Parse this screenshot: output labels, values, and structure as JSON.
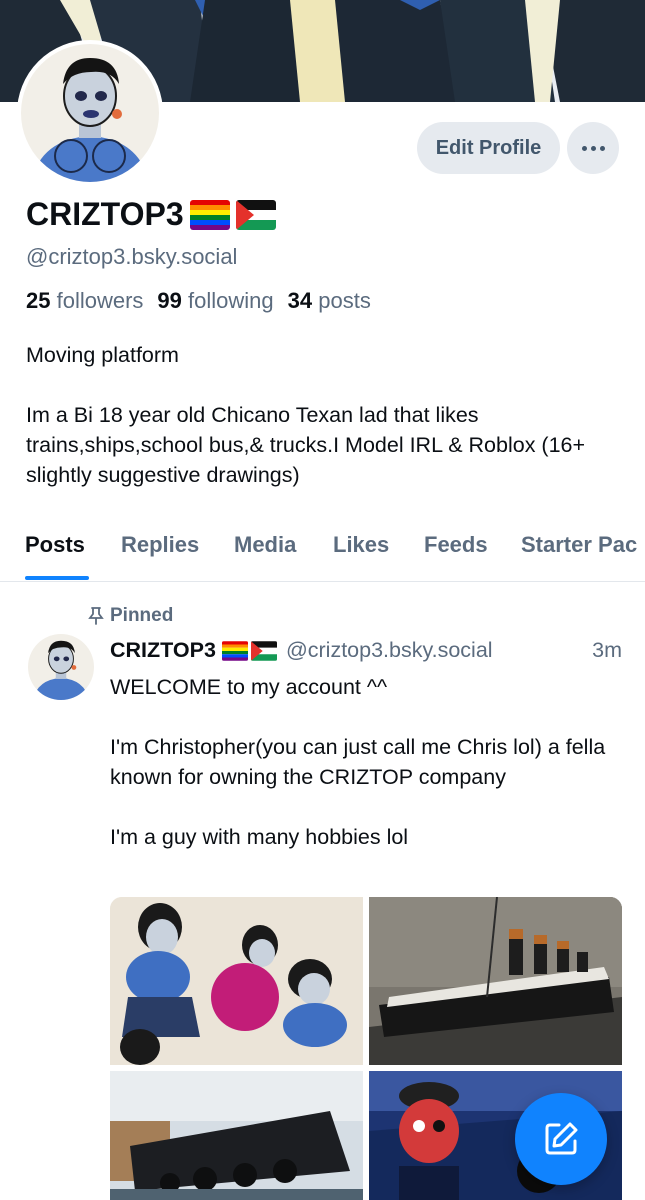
{
  "profile": {
    "display_name": "CRIZTOP3",
    "handle": "@criztop3.bsky.social",
    "edit_label": "Edit Profile",
    "stats": {
      "followers_count": "25",
      "followers_label": "followers",
      "following_count": "99",
      "following_label": "following",
      "posts_count": "34",
      "posts_label": "posts"
    },
    "bio_line1": "Moving platform",
    "bio_line2": "Im a Bi 18 year old Chicano Texan lad that likes trains,ships,school bus,& trucks.I Model IRL & Roblox (16+ slightly suggestive drawings)"
  },
  "tabs": [
    "Posts",
    "Replies",
    "Media",
    "Likes",
    "Feeds",
    "Starter Pac"
  ],
  "post": {
    "pinned_label": "Pinned",
    "author": "CRIZTOP3",
    "handle": "@criztop3.bsky.social",
    "time": "3m",
    "text1": "WELCOME to my account ^^",
    "text2": "I'm Christopher(you can just call me Chris lol) a fella known for owning the CRIZTOP company",
    "text3": "I'm a guy with many hobbies lol"
  },
  "colors": {
    "accent": "#1083fe",
    "muted": "#5b6b7e"
  },
  "icons": [
    "more-icon",
    "pin-icon",
    "compose-icon",
    "pride-flag-icon",
    "palestine-flag-icon"
  ]
}
